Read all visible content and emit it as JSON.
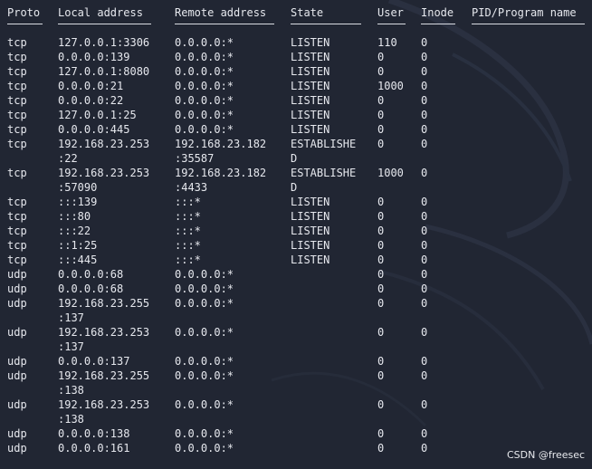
{
  "colors": {
    "background": "#212633",
    "text": "#e6e8ee"
  },
  "headers": {
    "proto": "Proto",
    "local": "Local address",
    "remote": "Remote address",
    "state": "State",
    "user": "User",
    "inode": "Inode",
    "pid": "PID/Program name"
  },
  "rows": [
    {
      "proto": "tcp",
      "local": [
        "127.0.0.1:3306"
      ],
      "remote": [
        "0.0.0.0:*"
      ],
      "state": [
        "LISTEN"
      ],
      "user": "110",
      "inode": "0"
    },
    {
      "proto": "tcp",
      "local": [
        "0.0.0.0:139"
      ],
      "remote": [
        "0.0.0.0:*"
      ],
      "state": [
        "LISTEN"
      ],
      "user": "0",
      "inode": "0"
    },
    {
      "proto": "tcp",
      "local": [
        "127.0.0.1:8080"
      ],
      "remote": [
        "0.0.0.0:*"
      ],
      "state": [
        "LISTEN"
      ],
      "user": "0",
      "inode": "0"
    },
    {
      "proto": "tcp",
      "local": [
        "0.0.0.0:21"
      ],
      "remote": [
        "0.0.0.0:*"
      ],
      "state": [
        "LISTEN"
      ],
      "user": "1000",
      "inode": "0"
    },
    {
      "proto": "tcp",
      "local": [
        "0.0.0.0:22"
      ],
      "remote": [
        "0.0.0.0:*"
      ],
      "state": [
        "LISTEN"
      ],
      "user": "0",
      "inode": "0"
    },
    {
      "proto": "tcp",
      "local": [
        "127.0.0.1:25"
      ],
      "remote": [
        "0.0.0.0:*"
      ],
      "state": [
        "LISTEN"
      ],
      "user": "0",
      "inode": "0"
    },
    {
      "proto": "tcp",
      "local": [
        "0.0.0.0:445"
      ],
      "remote": [
        "0.0.0.0:*"
      ],
      "state": [
        "LISTEN"
      ],
      "user": "0",
      "inode": "0"
    },
    {
      "proto": "tcp",
      "local": [
        "192.168.23.253",
        ":22"
      ],
      "remote": [
        "192.168.23.182",
        ":35587"
      ],
      "state": [
        "ESTABLISHE",
        "D"
      ],
      "user": "0",
      "inode": "0"
    },
    {
      "proto": "tcp",
      "local": [
        "192.168.23.253",
        ":57090"
      ],
      "remote": [
        "192.168.23.182",
        ":4433"
      ],
      "state": [
        "ESTABLISHE",
        "D"
      ],
      "user": "1000",
      "inode": "0"
    },
    {
      "proto": "tcp",
      "local": [
        ":::139"
      ],
      "remote": [
        ":::*"
      ],
      "state": [
        "LISTEN"
      ],
      "user": "0",
      "inode": "0"
    },
    {
      "proto": "tcp",
      "local": [
        ":::80"
      ],
      "remote": [
        ":::*"
      ],
      "state": [
        "LISTEN"
      ],
      "user": "0",
      "inode": "0"
    },
    {
      "proto": "tcp",
      "local": [
        ":::22"
      ],
      "remote": [
        ":::*"
      ],
      "state": [
        "LISTEN"
      ],
      "user": "0",
      "inode": "0"
    },
    {
      "proto": "tcp",
      "local": [
        "::1:25"
      ],
      "remote": [
        ":::*"
      ],
      "state": [
        "LISTEN"
      ],
      "user": "0",
      "inode": "0"
    },
    {
      "proto": "tcp",
      "local": [
        ":::445"
      ],
      "remote": [
        ":::*"
      ],
      "state": [
        "LISTEN"
      ],
      "user": "0",
      "inode": "0"
    },
    {
      "proto": "udp",
      "local": [
        "0.0.0.0:68"
      ],
      "remote": [
        "0.0.0.0:*"
      ],
      "state": [
        ""
      ],
      "user": "0",
      "inode": "0"
    },
    {
      "proto": "udp",
      "local": [
        "0.0.0.0:68"
      ],
      "remote": [
        "0.0.0.0:*"
      ],
      "state": [
        ""
      ],
      "user": "0",
      "inode": "0"
    },
    {
      "proto": "udp",
      "local": [
        "192.168.23.255",
        ":137"
      ],
      "remote": [
        "0.0.0.0:*"
      ],
      "state": [
        ""
      ],
      "user": "0",
      "inode": "0"
    },
    {
      "proto": "udp",
      "local": [
        "192.168.23.253",
        ":137"
      ],
      "remote": [
        "0.0.0.0:*"
      ],
      "state": [
        ""
      ],
      "user": "0",
      "inode": "0"
    },
    {
      "proto": "udp",
      "local": [
        "0.0.0.0:137"
      ],
      "remote": [
        "0.0.0.0:*"
      ],
      "state": [
        ""
      ],
      "user": "0",
      "inode": "0"
    },
    {
      "proto": "udp",
      "local": [
        "192.168.23.255",
        ":138"
      ],
      "remote": [
        "0.0.0.0:*"
      ],
      "state": [
        ""
      ],
      "user": "0",
      "inode": "0"
    },
    {
      "proto": "udp",
      "local": [
        "192.168.23.253",
        ":138"
      ],
      "remote": [
        "0.0.0.0:*"
      ],
      "state": [
        ""
      ],
      "user": "0",
      "inode": "0"
    },
    {
      "proto": "udp",
      "local": [
        "0.0.0.0:138"
      ],
      "remote": [
        "0.0.0.0:*"
      ],
      "state": [
        ""
      ],
      "user": "0",
      "inode": "0"
    },
    {
      "proto": "udp",
      "local": [
        "0.0.0.0:161"
      ],
      "remote": [
        "0.0.0.0:*"
      ],
      "state": [
        ""
      ],
      "user": "0",
      "inode": "0"
    }
  ],
  "watermark": "CSDN @freesec"
}
